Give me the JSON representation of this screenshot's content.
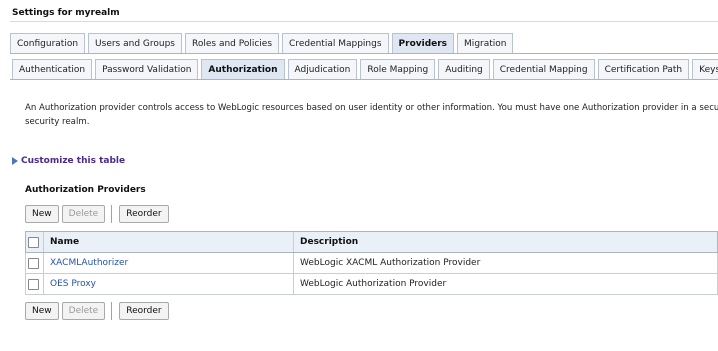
{
  "page": {
    "title": "Settings for myrealm"
  },
  "tabs_top": [
    {
      "label": "Configuration",
      "active": false
    },
    {
      "label": "Users and Groups",
      "active": false
    },
    {
      "label": "Roles and Policies",
      "active": false
    },
    {
      "label": "Credential Mappings",
      "active": false
    },
    {
      "label": "Providers",
      "active": true
    },
    {
      "label": "Migration",
      "active": false
    }
  ],
  "tabs_sub": [
    {
      "label": "Authentication",
      "active": false
    },
    {
      "label": "Password Validation",
      "active": false
    },
    {
      "label": "Authorization",
      "active": true
    },
    {
      "label": "Adjudication",
      "active": false
    },
    {
      "label": "Role Mapping",
      "active": false
    },
    {
      "label": "Auditing",
      "active": false
    },
    {
      "label": "Credential Mapping",
      "active": false
    },
    {
      "label": "Certification Path",
      "active": false
    },
    {
      "label": "Keystores",
      "active": false
    }
  ],
  "description": {
    "line1": "An Authorization provider controls access to WebLogic resources based on user identity or other information. You must have one Authorization provider in a security re",
    "line2": "security realm."
  },
  "customize": {
    "label": "Customize this table"
  },
  "section": {
    "title": "Authorization Providers"
  },
  "buttons": {
    "new": "New",
    "delete": "Delete",
    "reorder": "Reorder"
  },
  "table": {
    "headers": {
      "name": "Name",
      "description": "Description"
    },
    "rows": [
      {
        "name": "XACMLAuthorizer",
        "description": "WebLogic XACML Authorization Provider"
      },
      {
        "name": "OES Proxy",
        "description": "WebLogic Authorization Provider"
      }
    ]
  }
}
